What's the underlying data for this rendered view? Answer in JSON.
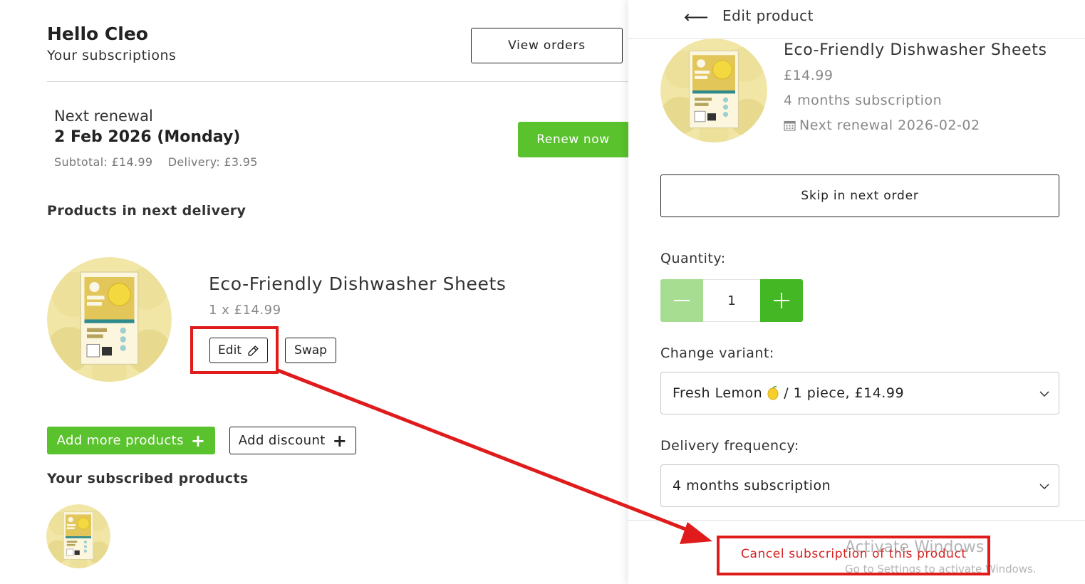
{
  "header": {
    "greeting": "Hello Cleo",
    "subtitle": "Your subscriptions",
    "view_orders_label": "View orders"
  },
  "renewal": {
    "label": "Next renewal",
    "date": "2 Feb 2026 (Monday)",
    "subtotal": "Subtotal: £14.99",
    "delivery": "Delivery: £3.95",
    "renew_label": "Renew now"
  },
  "next_delivery": {
    "heading": "Products in next delivery",
    "product_name": "Eco-Friendly Dishwasher Sheets",
    "product_qty": "1 x £14.99",
    "edit_label": "Edit",
    "swap_label": "Swap"
  },
  "actions": {
    "add_more_label": "Add more products",
    "add_discount_label": "Add discount"
  },
  "subscribed": {
    "heading": "Your subscribed products"
  },
  "panel": {
    "title": "Edit product",
    "product_name": "Eco-Friendly Dishwasher Sheets",
    "price": "£14.99",
    "subscription": "4 months subscription",
    "next_renewal": "Next renewal 2026-02-02",
    "skip_label": "Skip in next order",
    "quantity_label": "Quantity:",
    "quantity_value": "1",
    "variant_label": "Change variant:",
    "variant_value_part1": "Fresh Lemon",
    "variant_value_part2": "/ 1 piece, £14.99",
    "frequency_label": "Delivery frequency:",
    "frequency_value": "4 months subscription",
    "cancel_label": "Cancel subscription of this product"
  },
  "watermark": {
    "line1": "Activate Windows",
    "line2": "Go to Settings to activate Windows."
  },
  "icons": {
    "back": "arrow-left-icon",
    "edit": "pencil-icon",
    "plus": "plus-icon",
    "minus": "minus-icon",
    "calendar": "calendar-icon",
    "chevron": "chevron-down-icon",
    "lemon": "lemon-emoji-icon"
  },
  "colors": {
    "brand_green": "#5ac22d",
    "light_green": "#a6dd90",
    "danger_red": "#d62020",
    "highlight_red": "#e01b1b"
  }
}
